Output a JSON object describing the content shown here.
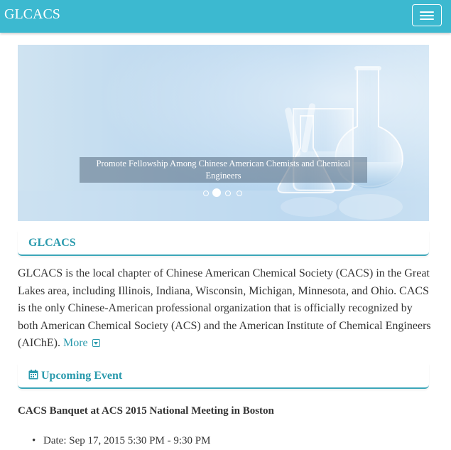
{
  "navbar": {
    "brand": "GLCACS",
    "toggle_icon": "menu-icon",
    "color": "#3cb9d0"
  },
  "carousel": {
    "caption": "Promote Fellowship Among Chinese American Chemists and Chemical Engineers",
    "active_index": 1,
    "slide_count": 4
  },
  "about": {
    "heading": "GLCACS",
    "body": "GLCACS is the local chapter of Chinese American Chemical Society (CACS) in the Great Lakes area, including Illinois, Indiana, Wisconsin, Michigan, Minnesota, and Ohio. CACS is the only Chinese-American professional organization that is officially recognized by both American Chemical Society (ACS) and the American Institute of Chemical Engineers (AIChE).",
    "more_label": "More",
    "more_icon": "chevron-down-square-icon"
  },
  "events": {
    "heading": "Upcoming Event",
    "heading_icon": "calendar-icon",
    "title": "CACS Banquet at ACS 2015 National Meeting in Boston",
    "details": [
      "Date: Sep 17, 2015 5:30 PM - 9:30 PM"
    ]
  },
  "colors": {
    "accent": "#2a9aad",
    "text": "#333333"
  }
}
